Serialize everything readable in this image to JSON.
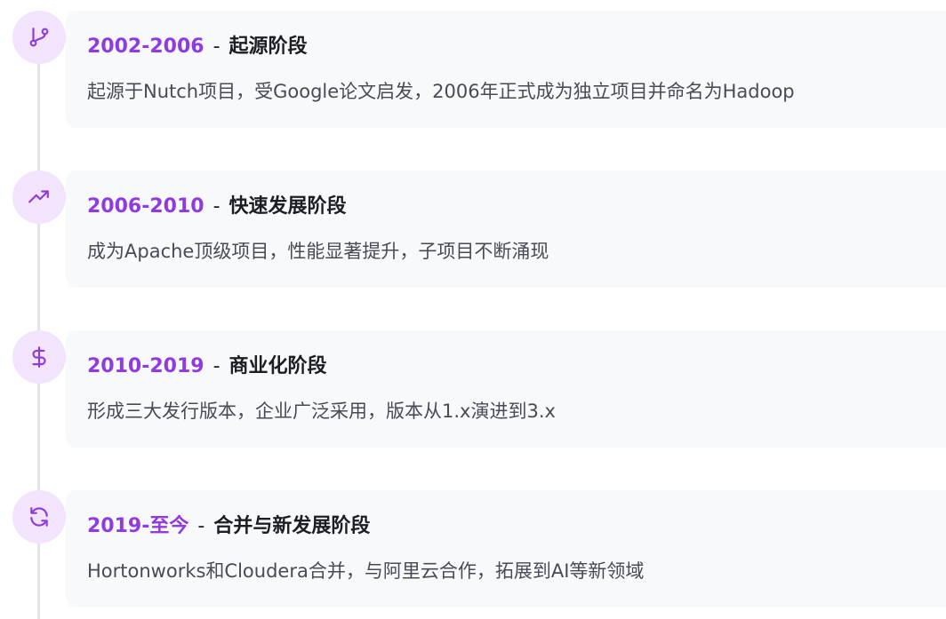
{
  "timeline": {
    "items": [
      {
        "icon": "git-branch-icon",
        "period": "2002-2006",
        "separator": "-",
        "title": "起源阶段",
        "description": "起源于Nutch项目，受Google论文启发，2006年正式成为独立项目并命名为Hadoop"
      },
      {
        "icon": "trending-up-icon",
        "period": "2006-2010",
        "separator": "-",
        "title": "快速发展阶段",
        "description": "成为Apache顶级项目，性能显著提升，子项目不断涌现"
      },
      {
        "icon": "dollar-sign-icon",
        "period": "2010-2019",
        "separator": "-",
        "title": "商业化阶段",
        "description": "形成三大发行版本，企业广泛采用，版本从1.x演进到3.x"
      },
      {
        "icon": "refresh-icon",
        "period": "2019-至今",
        "separator": "-",
        "title": "合并与新发展阶段",
        "description": "Hortonworks和Cloudera合并，与阿里云合作，拓展到AI等新领域"
      }
    ],
    "colors": {
      "accent": "#8f3be0",
      "icon_bg": "#f2e4fd",
      "card_bg": "#f8f9fb",
      "line": "#e3e3e8"
    }
  }
}
